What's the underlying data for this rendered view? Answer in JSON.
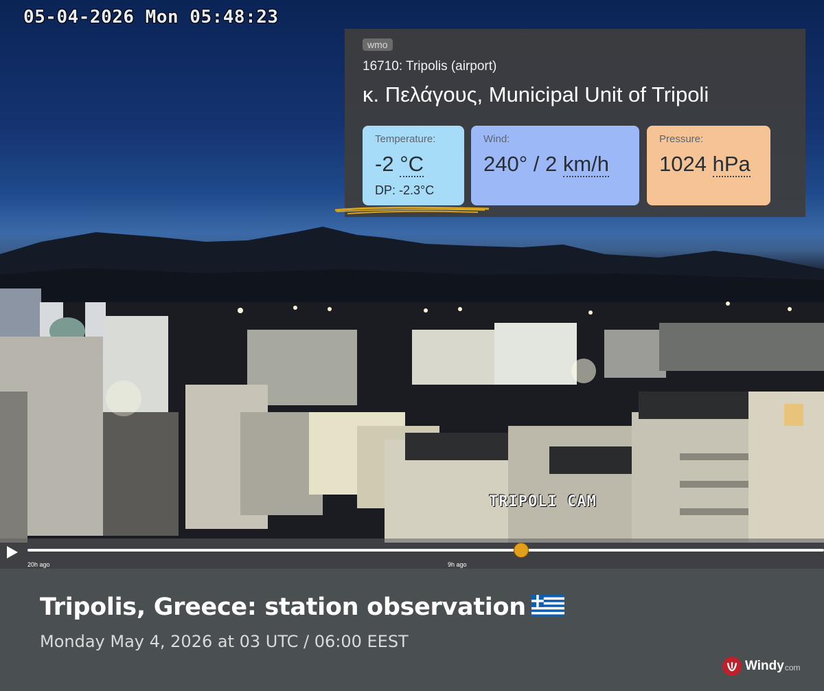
{
  "webcam": {
    "timestamp": "05-04-2026 Mon 05:48:23",
    "overlay_label": "TRIPOLI CAM"
  },
  "station": {
    "tag": "wmo",
    "id_line": "16710: Tripolis (airport)",
    "place": "κ. Πελάγους, Municipal Unit of Tripoli",
    "temperature": {
      "label": "Temperature:",
      "value": "-2",
      "unit": "°C",
      "dew_point": "DP: -2.3°C"
    },
    "wind": {
      "label": "Wind:",
      "value": "240° / 2",
      "unit": "km/h"
    },
    "pressure": {
      "label": "Pressure:",
      "value": "1024",
      "unit": "hPa"
    }
  },
  "timeline": {
    "start_label": "20h ago",
    "mid_label": "9h ago",
    "position_fraction": 0.62
  },
  "info": {
    "headline": "Tripolis, Greece: station observation",
    "flag_icon": "greece-flag-icon",
    "subline": "Monday May 4, 2026 at 03 UTC / 06:00 EEST"
  },
  "brand": {
    "name": "Windy",
    "suffix": "com"
  },
  "colors": {
    "temperature_tile": "#a6dcf7",
    "wind_tile": "#9db8f6",
    "pressure_tile": "#f6c394",
    "timeline_knob": "#e2a01a",
    "brand_red": "#c0202b"
  }
}
